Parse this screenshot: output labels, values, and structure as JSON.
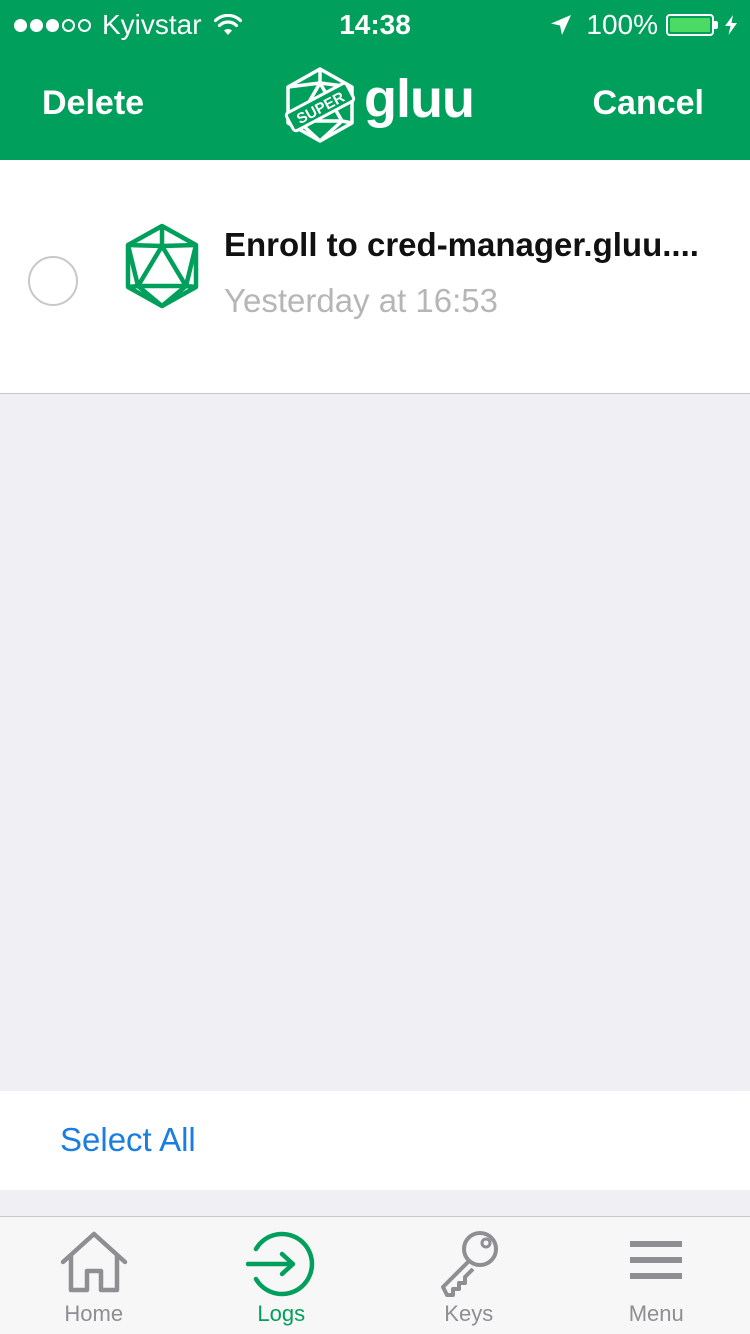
{
  "status_bar": {
    "carrier": "Kyivstar",
    "time": "14:38",
    "battery_percent": "100%",
    "signal_bars_filled": 3,
    "signal_bars_total": 5
  },
  "nav": {
    "left_button": "Delete",
    "right_button": "Cancel",
    "logo_badge": "SUPER",
    "logo_text": "gluu"
  },
  "logs": [
    {
      "title": "Enroll to cred-manager.gluu....",
      "time": "Yesterday at 16:53",
      "selected": false,
      "icon": "gluu-icosahedron-icon"
    }
  ],
  "actions": {
    "select_all": "Select All"
  },
  "tabs": [
    {
      "label": "Home",
      "icon": "home-icon",
      "active": false
    },
    {
      "label": "Logs",
      "icon": "logs-icon",
      "active": true
    },
    {
      "label": "Keys",
      "icon": "key-icon",
      "active": false
    },
    {
      "label": "Menu",
      "icon": "menu-icon",
      "active": false
    }
  ],
  "colors": {
    "brand_green": "#00a05c",
    "link_blue": "#1a7de0",
    "background": "#efeff4",
    "tab_inactive": "#8e8e93"
  }
}
